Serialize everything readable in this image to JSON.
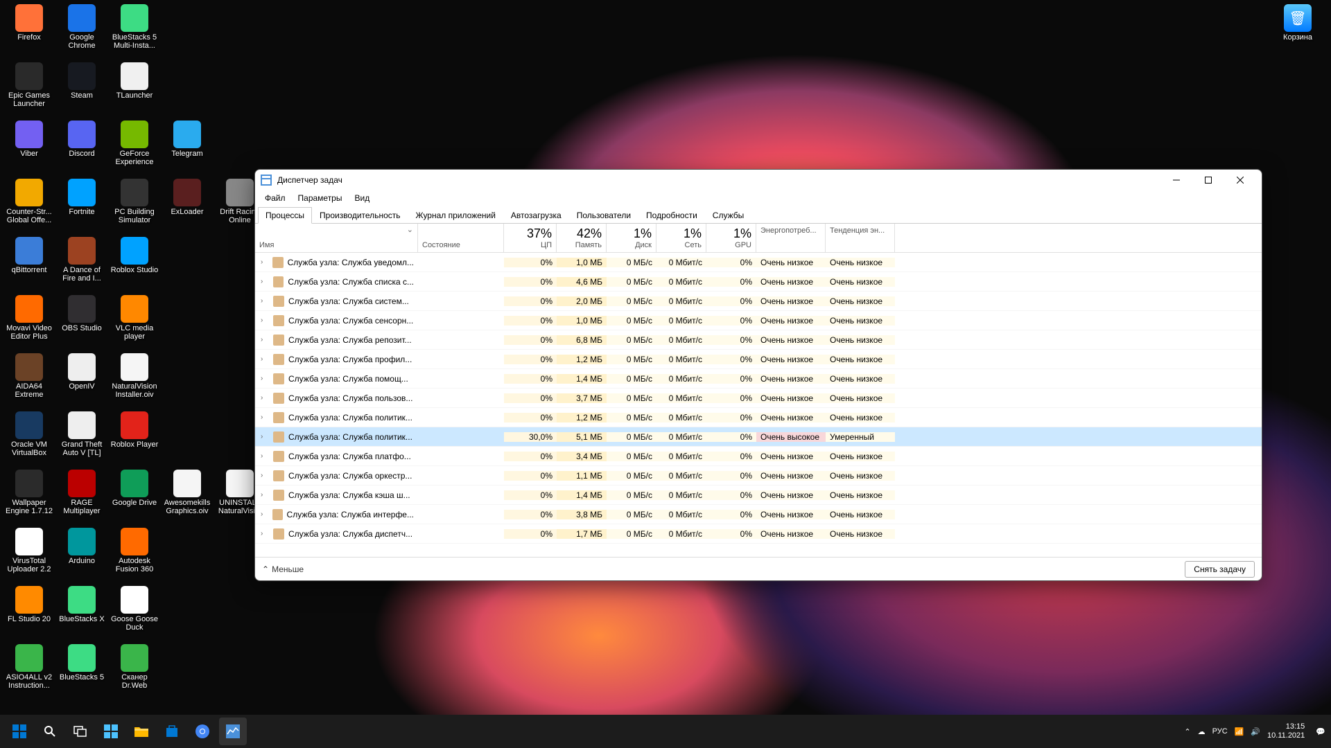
{
  "desktop": {
    "icons": [
      {
        "label": "Firefox",
        "c": "#ff7139"
      },
      {
        "label": "Google Chrome",
        "c": "#1a73e8"
      },
      {
        "label": "BlueStacks 5 Multi-Insta...",
        "c": "#3ddc84"
      },
      {
        "label": "",
        "c": ""
      },
      {
        "label": "",
        "c": ""
      },
      {
        "label": "Epic Games Launcher",
        "c": "#2a2a2a"
      },
      {
        "label": "Steam",
        "c": "#171a21"
      },
      {
        "label": "TLauncher",
        "c": "#f0f0f0"
      },
      {
        "label": "",
        "c": ""
      },
      {
        "label": "",
        "c": ""
      },
      {
        "label": "Viber",
        "c": "#7360f2"
      },
      {
        "label": "Discord",
        "c": "#5865f2"
      },
      {
        "label": "GeForce Experience",
        "c": "#76b900"
      },
      {
        "label": "Telegram",
        "c": "#2aabee"
      },
      {
        "label": "",
        "c": ""
      },
      {
        "label": "Counter-Str... Global Offe...",
        "c": "#f2a900"
      },
      {
        "label": "Fortnite",
        "c": "#00a2ff"
      },
      {
        "label": "PC Building Simulator",
        "c": "#333"
      },
      {
        "label": "ExLoader",
        "c": "#5a1f1f"
      },
      {
        "label": "Drift Racing Online",
        "c": "#888"
      },
      {
        "label": "qBittorrent",
        "c": "#3b7dd8"
      },
      {
        "label": "A Dance of Fire and I...",
        "c": "#9c4221"
      },
      {
        "label": "Roblox Studio",
        "c": "#00a2ff"
      },
      {
        "label": "",
        "c": ""
      },
      {
        "label": "",
        "c": ""
      },
      {
        "label": "Movavi Video Editor Plus",
        "c": "#ff6a00"
      },
      {
        "label": "OBS Studio",
        "c": "#302e31"
      },
      {
        "label": "VLC media player",
        "c": "#ff8800"
      },
      {
        "label": "",
        "c": ""
      },
      {
        "label": "",
        "c": ""
      },
      {
        "label": "AIDA64 Extreme",
        "c": "#6b4226"
      },
      {
        "label": "OpenIV",
        "c": "#eee"
      },
      {
        "label": "NaturalVision Installer.oiv",
        "c": "#f5f5f5"
      },
      {
        "label": "",
        "c": ""
      },
      {
        "label": "",
        "c": ""
      },
      {
        "label": "Oracle VM VirtualBox",
        "c": "#183a61"
      },
      {
        "label": "Grand Theft Auto V [TL]",
        "c": "#eee"
      },
      {
        "label": "Roblox Player",
        "c": "#e2231a"
      },
      {
        "label": "",
        "c": ""
      },
      {
        "label": "",
        "c": ""
      },
      {
        "label": "Wallpaper Engine 1.7.12",
        "c": "#2b2b2b"
      },
      {
        "label": "RAGE Multiplayer",
        "c": "#b00"
      },
      {
        "label": "Google Drive",
        "c": "#0f9d58"
      },
      {
        "label": "Awesomekills Graphics.oiv",
        "c": "#f5f5f5"
      },
      {
        "label": "UNINSTALL NaturalVisi...",
        "c": "#f5f5f5"
      },
      {
        "label": "VirusTotal Uploader 2.2",
        "c": "#fff"
      },
      {
        "label": "Arduino",
        "c": "#00979d"
      },
      {
        "label": "Autodesk Fusion 360",
        "c": "#ff6a00"
      },
      {
        "label": "",
        "c": ""
      },
      {
        "label": "",
        "c": ""
      },
      {
        "label": "FL Studio 20",
        "c": "#ff8a00"
      },
      {
        "label": "BlueStacks X",
        "c": "#3ddc84"
      },
      {
        "label": "Goose Goose Duck",
        "c": "#fff"
      },
      {
        "label": "",
        "c": ""
      },
      {
        "label": "",
        "c": ""
      },
      {
        "label": "ASIO4ALL v2 Instruction...",
        "c": "#3ab54a"
      },
      {
        "label": "BlueStacks 5",
        "c": "#3ddc84"
      },
      {
        "label": "Сканер Dr.Web",
        "c": "#3ab54a"
      },
      {
        "label": "",
        "c": ""
      },
      {
        "label": "",
        "c": ""
      }
    ],
    "recycle": "Корзина"
  },
  "taskmgr": {
    "title": "Диспетчер задач",
    "menus": [
      "Файл",
      "Параметры",
      "Вид"
    ],
    "tabs": [
      "Процессы",
      "Производительность",
      "Журнал приложений",
      "Автозагрузка",
      "Пользователи",
      "Подробности",
      "Службы"
    ],
    "active_tab": 0,
    "columns": {
      "name": "Имя",
      "state": "Состояние",
      "cpu": {
        "pct": "37%",
        "label": "ЦП"
      },
      "mem": {
        "pct": "42%",
        "label": "Память"
      },
      "disk": {
        "pct": "1%",
        "label": "Диск"
      },
      "net": {
        "pct": "1%",
        "label": "Сеть"
      },
      "gpu": {
        "pct": "1%",
        "label": "GPU"
      },
      "power": "Энергопотреб...",
      "trend": "Тенденция эн..."
    },
    "rows": [
      {
        "name": "Служба узла: Служба уведомл...",
        "cpu": "0%",
        "mem": "1,0 МБ",
        "disk": "0 МБ/с",
        "net": "0 Мбит/с",
        "gpu": "0%",
        "power": "Очень низкое",
        "trend": "Очень низкое"
      },
      {
        "name": "Служба узла: Служба списка с...",
        "cpu": "0%",
        "mem": "4,6 МБ",
        "disk": "0 МБ/с",
        "net": "0 Мбит/с",
        "gpu": "0%",
        "power": "Очень низкое",
        "trend": "Очень низкое"
      },
      {
        "name": "Служба узла: Служба систем...",
        "cpu": "0%",
        "mem": "2,0 МБ",
        "disk": "0 МБ/с",
        "net": "0 Мбит/с",
        "gpu": "0%",
        "power": "Очень низкое",
        "trend": "Очень низкое"
      },
      {
        "name": "Служба узла: Служба сенсорн...",
        "cpu": "0%",
        "mem": "1,0 МБ",
        "disk": "0 МБ/с",
        "net": "0 Мбит/с",
        "gpu": "0%",
        "power": "Очень низкое",
        "trend": "Очень низкое"
      },
      {
        "name": "Служба узла: Служба репозит...",
        "cpu": "0%",
        "mem": "6,8 МБ",
        "disk": "0 МБ/с",
        "net": "0 Мбит/с",
        "gpu": "0%",
        "power": "Очень низкое",
        "trend": "Очень низкое"
      },
      {
        "name": "Служба узла: Служба профил...",
        "cpu": "0%",
        "mem": "1,2 МБ",
        "disk": "0 МБ/с",
        "net": "0 Мбит/с",
        "gpu": "0%",
        "power": "Очень низкое",
        "trend": "Очень низкое"
      },
      {
        "name": "Служба узла: Служба помощ...",
        "cpu": "0%",
        "mem": "1,4 МБ",
        "disk": "0 МБ/с",
        "net": "0 Мбит/с",
        "gpu": "0%",
        "power": "Очень низкое",
        "trend": "Очень низкое"
      },
      {
        "name": "Служба узла: Служба пользов...",
        "cpu": "0%",
        "mem": "3,7 МБ",
        "disk": "0 МБ/с",
        "net": "0 Мбит/с",
        "gpu": "0%",
        "power": "Очень низкое",
        "trend": "Очень низкое"
      },
      {
        "name": "Служба узла: Служба политик...",
        "cpu": "0%",
        "mem": "1,2 МБ",
        "disk": "0 МБ/с",
        "net": "0 Мбит/с",
        "gpu": "0%",
        "power": "Очень низкое",
        "trend": "Очень низкое"
      },
      {
        "name": "Служба узла: Служба политик...",
        "cpu": "30,0%",
        "mem": "5,1 МБ",
        "disk": "0 МБ/с",
        "net": "0 Мбит/с",
        "gpu": "0%",
        "power": "Очень высокое",
        "trend": "Умеренный",
        "selected": true
      },
      {
        "name": "Служба узла: Служба платфо...",
        "cpu": "0%",
        "mem": "3,4 МБ",
        "disk": "0 МБ/с",
        "net": "0 Мбит/с",
        "gpu": "0%",
        "power": "Очень низкое",
        "trend": "Очень низкое"
      },
      {
        "name": "Служба узла: Служба оркестр...",
        "cpu": "0%",
        "mem": "1,1 МБ",
        "disk": "0 МБ/с",
        "net": "0 Мбит/с",
        "gpu": "0%",
        "power": "Очень низкое",
        "trend": "Очень низкое"
      },
      {
        "name": "Служба узла: Служба кэша ш...",
        "cpu": "0%",
        "mem": "1,4 МБ",
        "disk": "0 МБ/с",
        "net": "0 Мбит/с",
        "gpu": "0%",
        "power": "Очень низкое",
        "trend": "Очень низкое"
      },
      {
        "name": "Служба узла: Служба интерфе...",
        "cpu": "0%",
        "mem": "3,8 МБ",
        "disk": "0 МБ/с",
        "net": "0 Мбит/с",
        "gpu": "0%",
        "power": "Очень низкое",
        "trend": "Очень низкое"
      },
      {
        "name": "Служба узла: Служба диспетч...",
        "cpu": "0%",
        "mem": "1,7 МБ",
        "disk": "0 МБ/с",
        "net": "0 Мбит/с",
        "gpu": "0%",
        "power": "Очень низкое",
        "trend": "Очень низкое"
      }
    ],
    "less": "Меньше",
    "end_task": "Снять задачу"
  },
  "taskbar": {
    "lang": "РУС",
    "time": "13:15",
    "date": "10.11.2021"
  }
}
